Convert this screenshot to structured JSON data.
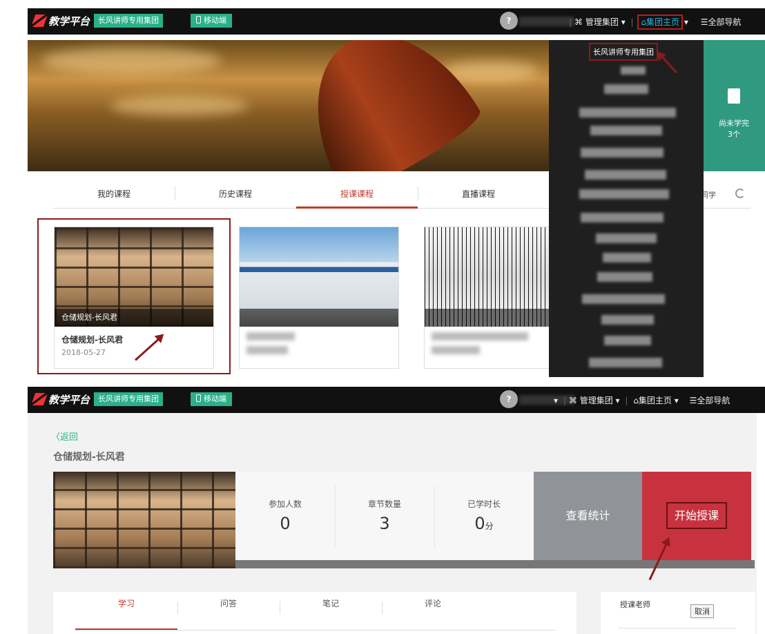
{
  "top_bar": {
    "logo": "教学平台",
    "group_button": "长风讲师专用集团",
    "mobile_button": "移动端",
    "avatar_glyph": "?",
    "manage_group": "管理集团",
    "group_home": "集团主页",
    "all_nav": "全部导航"
  },
  "hero": {
    "unfinished_label": "尚未学完",
    "unfinished_count": "3个"
  },
  "course_tabs": [
    "我的课程",
    "历史课程",
    "授课课程",
    "直播课程"
  ],
  "course_tabs_active": 2,
  "course_tabs_partial": "同学",
  "cards": [
    {
      "caption": "仓储规划-长风君",
      "title": "仓储规划-长风君",
      "date": "2018-05-27"
    }
  ],
  "dropdown": {
    "first_item": "长风讲师专用集团"
  },
  "detail": {
    "back": "〈返回",
    "course_title": "仓储规划-长风君",
    "stats": [
      {
        "label": "参加人数",
        "value": "0",
        "unit": ""
      },
      {
        "label": "章节数量",
        "value": "3",
        "unit": ""
      },
      {
        "label": "已学时长",
        "value": "0",
        "unit": "分"
      }
    ],
    "view_stats": "查看统计",
    "start_teaching": "开始授课",
    "tabs": [
      "学习",
      "问答",
      "笔记",
      "评论"
    ],
    "side_label": "授课老师",
    "cancel": "取消"
  },
  "colors": {
    "brand_green": "#2bb08a",
    "accent_red": "#c8323f",
    "annotation_red": "#8b1a1a"
  }
}
